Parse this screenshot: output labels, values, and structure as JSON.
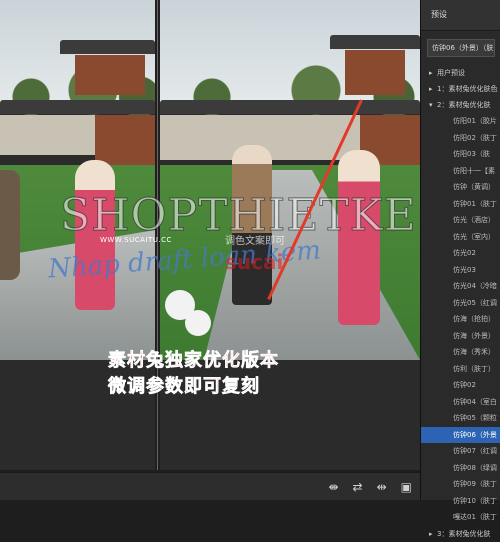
{
  "watermark": {
    "brand": "SHOPTHIETKE",
    "site": "WWW.SUCAITU.CC",
    "script": "Nhap draft loan kem",
    "mid": "调色文案即可",
    "logo": "sucai"
  },
  "overlay": {
    "line1": "素材兔独家优化版本",
    "line2": "微调参数即可复刻"
  },
  "toolbar": {
    "icons": [
      "compare-split-icon",
      "swap-icon",
      "compare-side-icon",
      "fullscreen-icon"
    ]
  },
  "panel": {
    "header": "预设",
    "selected_preset": "仿钟06（外景）（肤",
    "groups": [
      {
        "label": "用户预设",
        "expanded": false
      },
      {
        "label": "1：素材兔优化肤色",
        "expanded": false
      },
      {
        "label": "2：素材兔优化肤",
        "expanded": true
      }
    ],
    "items": [
      "仿阳01（胶片",
      "仿阳02（肤丁",
      "仿阳03（肤",
      "仿阳十一【素",
      "仿钟（黄调）",
      "仿钟01（肤丁",
      "仿光（酒店）",
      "仿光（室内）",
      "仿光02",
      "仿光03",
      "仿光04（冷暗",
      "仿光05（红调",
      "仿海（抢拍）",
      "仿海（外景）",
      "仿海（秀禾）",
      "仿利（肤丁）",
      "仿钟02",
      "仿钟04（室白",
      "仿钟05（颗粒",
      "仿钟06（外景",
      "仿钟07（红调",
      "仿钟08（绿调",
      "仿钟09（肤丁",
      "仿钟10（肤丁",
      "嘎达01（肤丁"
    ],
    "selected_index": 19,
    "group3": "3：素材兔优化肤"
  }
}
